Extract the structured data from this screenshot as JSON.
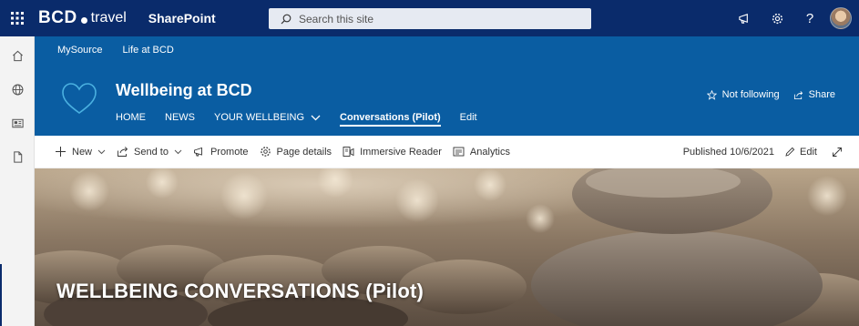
{
  "suite_bar": {
    "brand_letters": "BCD",
    "brand_word": "travel",
    "app_name": "SharePoint",
    "search_placeholder": "Search this site",
    "help_glyph": "?"
  },
  "hub_nav": {
    "items": [
      "MySource",
      "Life at BCD"
    ]
  },
  "site_header": {
    "title": "Wellbeing at BCD",
    "nav": [
      {
        "label": "HOME"
      },
      {
        "label": "NEWS"
      },
      {
        "label": "YOUR WELLBEING"
      },
      {
        "label": "Conversations (Pilot)"
      },
      {
        "label": "Edit"
      }
    ],
    "follow_label": "Not following",
    "share_label": "Share"
  },
  "command_bar": {
    "new_label": "New",
    "send_to_label": "Send to",
    "promote_label": "Promote",
    "page_details_label": "Page details",
    "immersive_reader_label": "Immersive Reader",
    "analytics_label": "Analytics",
    "published": "Published 10/6/2021",
    "edit_label": "Edit"
  },
  "hero": {
    "title": "WELLBEING CONVERSATIONS (Pilot)"
  },
  "icons": {
    "waffle": "waffle-icon",
    "search": "search-icon",
    "megaphone": "megaphone-icon",
    "settings": "gear-icon",
    "help": "help-icon",
    "home": "home-icon",
    "globe": "globe-icon",
    "news": "news-icon",
    "page": "page-icon",
    "site_logo": "heart-icon"
  },
  "colors": {
    "suite_bar": "#0a2b6b",
    "header": "#0a5da2"
  }
}
